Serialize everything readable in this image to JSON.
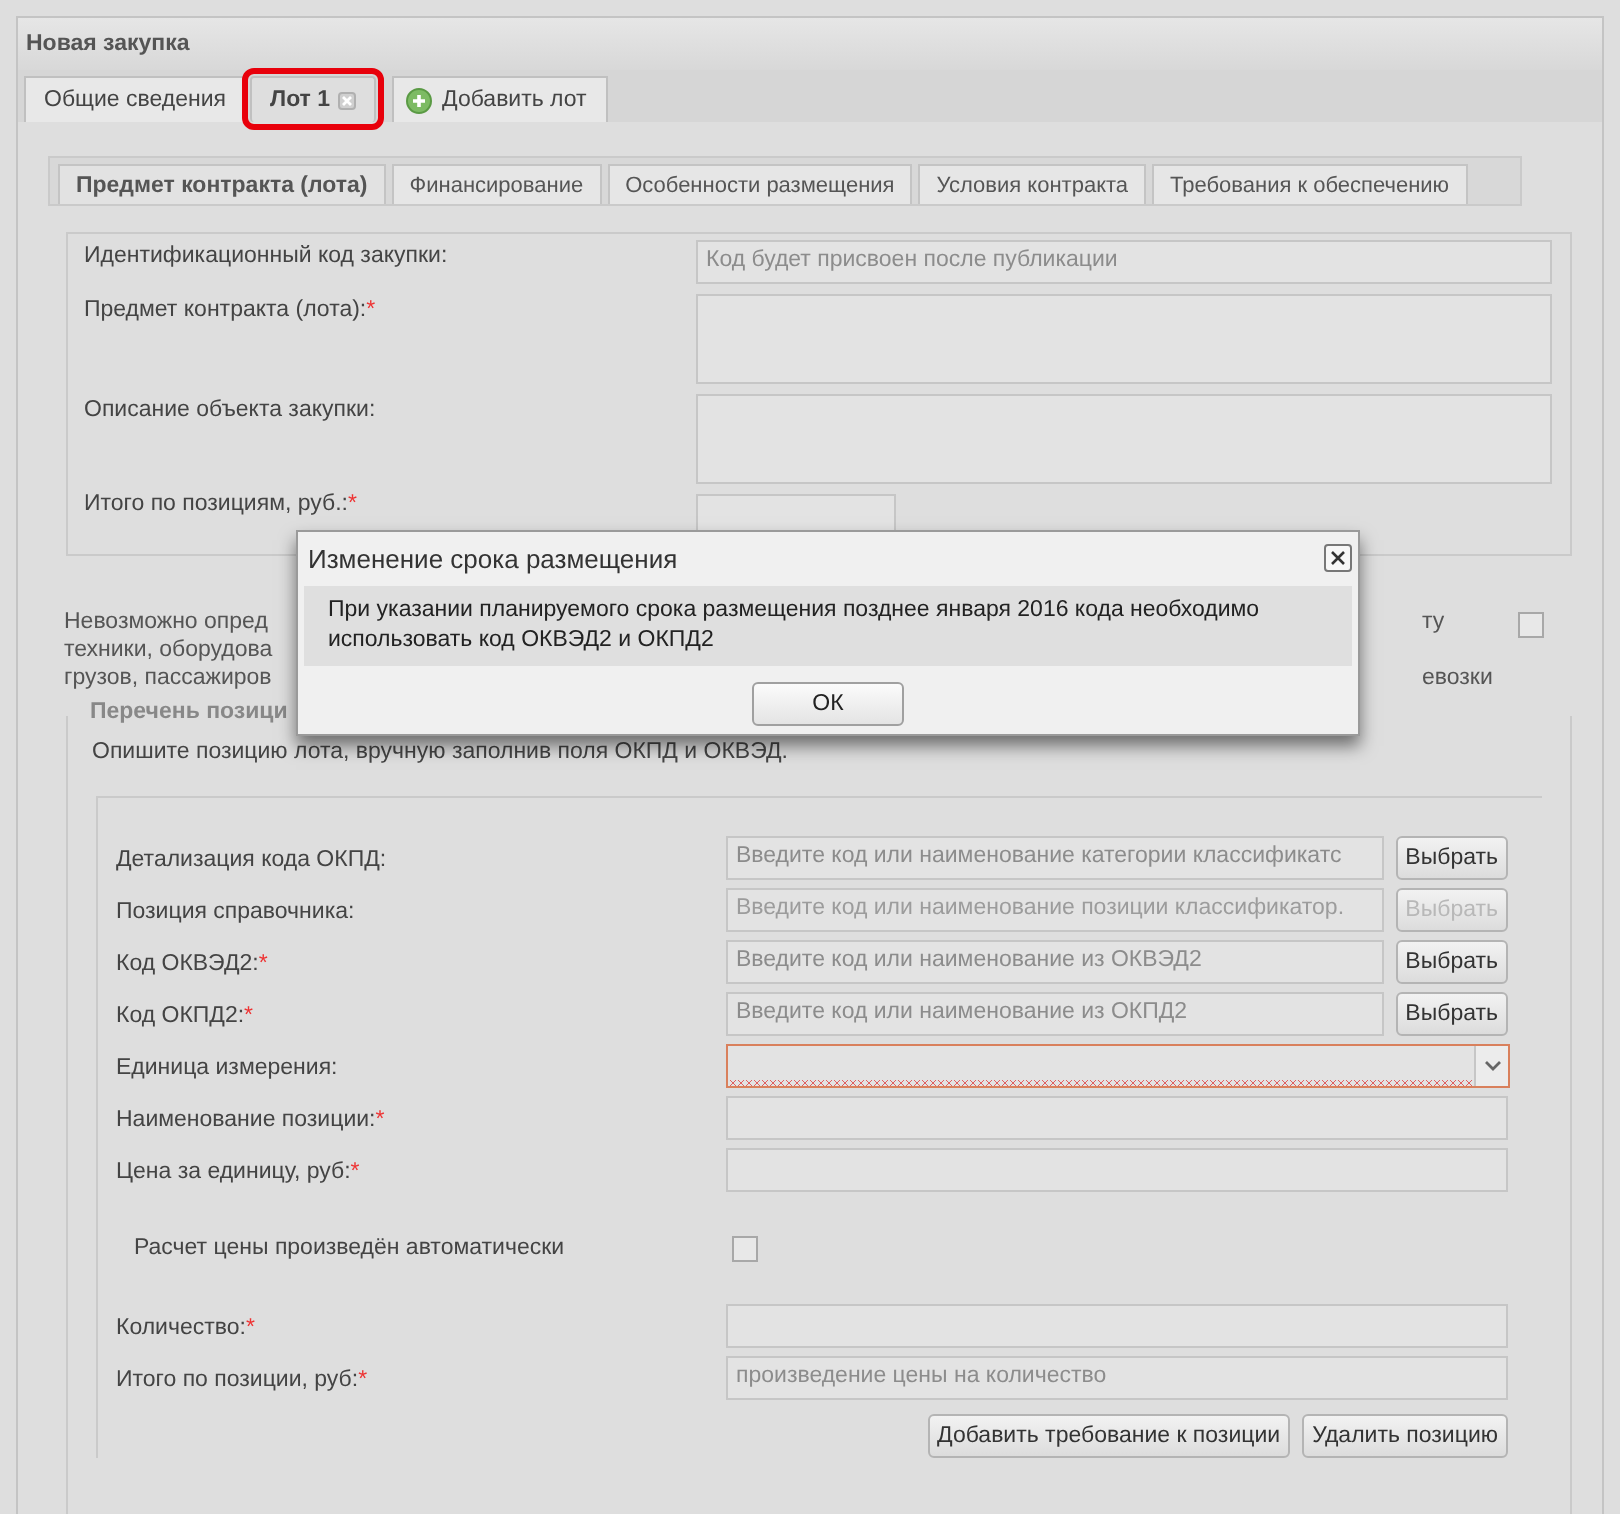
{
  "window": {
    "title": "Новая закупка"
  },
  "tabs": [
    {
      "label": "Общие сведения",
      "selected": false,
      "closable": false,
      "highlighted": false
    },
    {
      "label": "Лот 1",
      "selected": true,
      "closable": true,
      "highlighted": true
    }
  ],
  "add_tab": {
    "label": "Добавить лот"
  },
  "sub_tabs": [
    {
      "label": "Предмет контракта (лота)",
      "selected": true
    },
    {
      "label": "Финансирование",
      "selected": false
    },
    {
      "label": "Особенности размещения",
      "selected": false
    },
    {
      "label": "Условия контракта",
      "selected": false
    },
    {
      "label": "Требования к обеспечению",
      "selected": false
    }
  ],
  "contract_fields": [
    {
      "label": "Идентификационный код закупки:",
      "kind": "input",
      "placeholder": "Код будет присвоен после публикации"
    },
    {
      "label": "Предмет контракта (лота):",
      "required_mark": "*",
      "kind": "textarea"
    },
    {
      "label": "Описание объекта закупки:",
      "kind": "textarea"
    },
    {
      "label": "Итого по позициям, руб.:",
      "required_mark": "*",
      "kind": "short"
    }
  ],
  "notice": {
    "left_lines": [
      "Невозможно опред",
      "техники, оборудова",
      "грузов, пассажиров"
    ],
    "right_lines": [
      "ту",
      "евозки"
    ],
    "checked": false
  },
  "positions": {
    "legend": "Перечень позици",
    "hint": "Опишите позицию лота, вручную заполнив поля ОКПД и ОКВЭД.",
    "fields": [
      {
        "kind": "lookup",
        "label": "Детализация кода ОКПД:",
        "placeholder": "Введите код или наименование категории классификатс",
        "button": "Выбрать",
        "disabled": false
      },
      {
        "kind": "lookup",
        "label": "Позиция справочника:",
        "placeholder": "Введите код или наименование позиции классификатор.",
        "button": "Выбрать",
        "disabled": true
      },
      {
        "kind": "lookup",
        "label": "Код ОКВЭД2:",
        "required_mark": "*",
        "placeholder": "Введите код или наименование из ОКВЭД2",
        "button": "Выбрать",
        "disabled": false
      },
      {
        "kind": "lookup",
        "label": "Код ОКПД2:",
        "required_mark": "*",
        "placeholder": "Введите код или наименование из ОКПД2",
        "button": "Выбрать",
        "disabled": false
      },
      {
        "kind": "select",
        "label": "Единица измерения:",
        "invalid": true
      },
      {
        "kind": "input",
        "label": "Наименование позиции:",
        "required_mark": "*"
      },
      {
        "kind": "input",
        "label": "Цена за единицу, руб:",
        "required_mark": "*"
      },
      {
        "kind": "checkbox",
        "label": "Расчет цены произведён автоматически",
        "checked": false
      },
      {
        "kind": "input",
        "label": "Количество:",
        "required_mark": "*"
      },
      {
        "kind": "input",
        "label": "Итого по позиции, руб:",
        "required_mark": "*",
        "placeholder": "произведение цены на количество"
      }
    ],
    "buttons": [
      "Добавить требование к позиции",
      "Удалить позицию"
    ]
  },
  "dialog": {
    "title": "Изменение срока размещения",
    "message": "При указании планируемого срока размещения позднее января 2016 кода необходимо использовать код ОКВЭД2 и ОКПД2",
    "ok": "ОК"
  }
}
